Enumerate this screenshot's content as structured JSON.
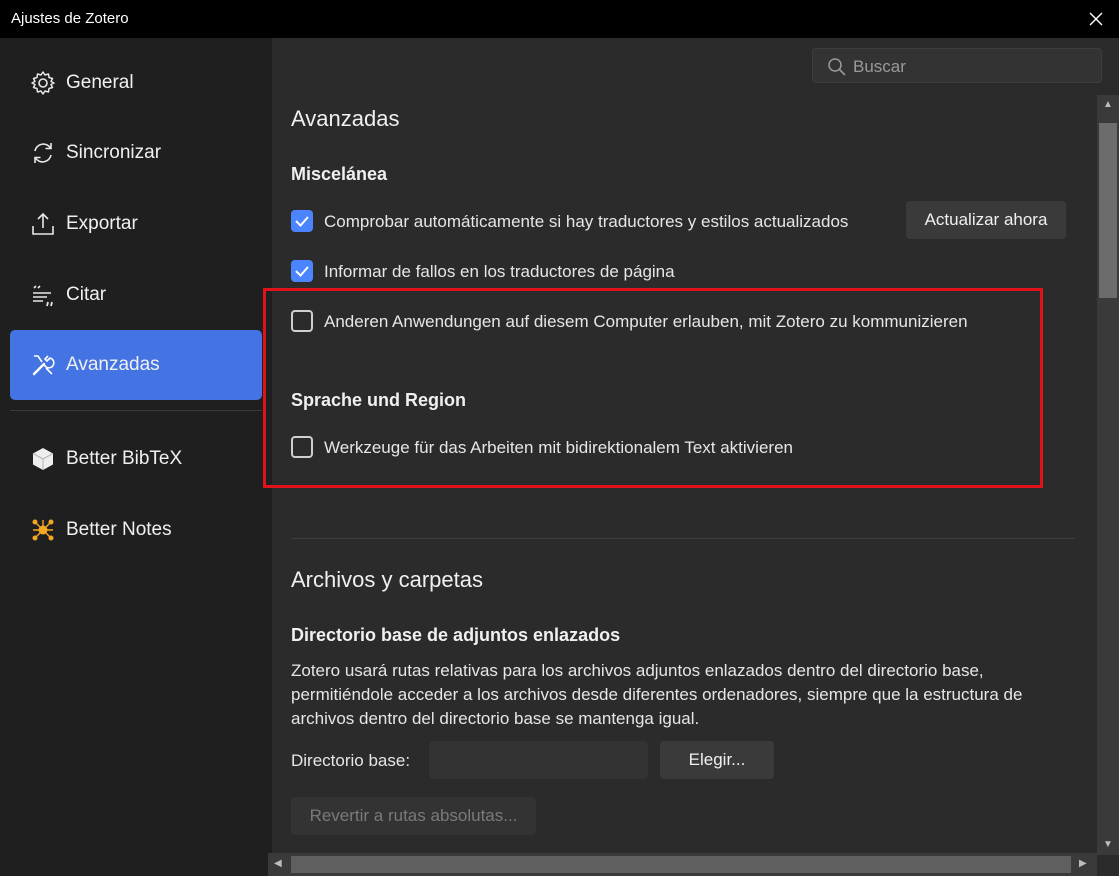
{
  "window": {
    "title": "Ajustes de Zotero"
  },
  "sidebar": {
    "items": [
      {
        "label": "General",
        "icon": "gear-icon",
        "active": false
      },
      {
        "label": "Sincronizar",
        "icon": "sync-icon",
        "active": false
      },
      {
        "label": "Exportar",
        "icon": "export-icon",
        "active": false
      },
      {
        "label": "Citar",
        "icon": "cite-icon",
        "active": false
      },
      {
        "label": "Avanzadas",
        "icon": "tools-icon",
        "active": true
      },
      {
        "label": "Better BibTeX",
        "icon": "bibtex-icon",
        "active": false
      },
      {
        "label": "Better Notes",
        "icon": "notes-icon",
        "active": false
      }
    ]
  },
  "search": {
    "placeholder": "Buscar"
  },
  "advanced": {
    "title": "Avanzadas",
    "misc_heading": "Miscelánea",
    "opt_auto_check": {
      "label": "Comprobar automáticamente si hay traductores y estilos actualizados",
      "checked": true
    },
    "update_now_label": "Actualizar ahora",
    "opt_report_errors": {
      "label": "Informar de fallos en los traductores de página",
      "checked": true
    },
    "opt_allow_apps": {
      "label": "Anderen Anwendungen auf diesem Computer erlauben, mit Zotero zu kommunizieren",
      "checked": false
    },
    "lang_heading": "Sprache und Region",
    "opt_bidi": {
      "label": "Werkzeuge für das Arbeiten mit bidirektionalem Text aktivieren",
      "checked": false
    }
  },
  "files": {
    "title": "Archivos y carpetas",
    "base_dir_heading": "Directorio base de adjuntos enlazados",
    "description_lines": [
      "Zotero usará rutas relativas para los archivos adjuntos enlazados dentro del directorio base,",
      "permitiéndole acceder a los archivos desde diferentes ordenadores, siempre que la estructura de",
      "archivos dentro del directorio base se mantenga igual."
    ],
    "base_dir_label": "Directorio base:",
    "base_dir_value": "",
    "choose_label": "Elegir...",
    "revert_label": "Revertir a rutas absolutas..."
  },
  "colors": {
    "accent": "#4473e3",
    "checkbox": "#4a84ff",
    "highlight": "#e0131b"
  }
}
